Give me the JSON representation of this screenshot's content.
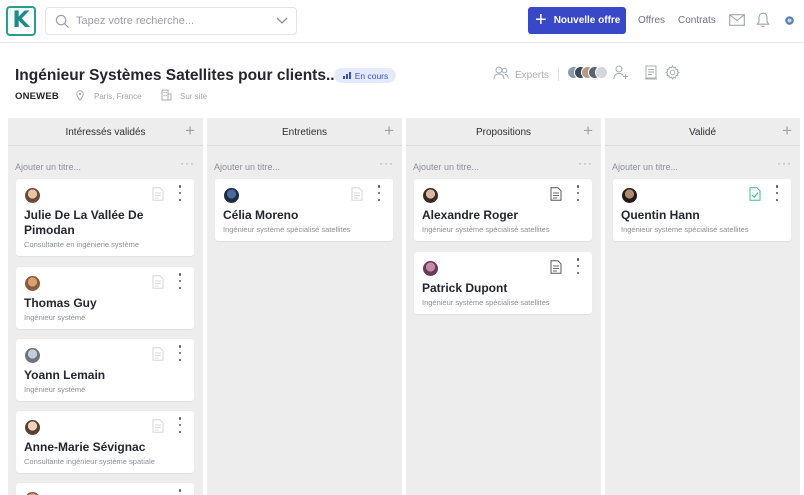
{
  "colors": {
    "accent": "#3848c8",
    "brand": "#2a9d8f",
    "status_bg": "#e4ebff",
    "column_bg": "#ededed"
  },
  "topbar": {
    "logo_letter": "K",
    "search_placeholder": "Tapez votre recherche...",
    "new_offer_label": "Nouvelle offre",
    "nav": [
      "Offres",
      "Contrats"
    ],
    "icons": [
      "mail-icon",
      "bell-icon",
      "user-avatar-icon"
    ]
  },
  "header": {
    "job_title": "Ingénieur Systèmes Satellites pour clients...",
    "status": "En cours",
    "company": "ONEWEB",
    "location": "Paris, France",
    "workplace": "Sur site",
    "experts_label": "Experts"
  },
  "columns": [
    {
      "title": "Intéressés validés",
      "add_title": "Ajouter un titre...",
      "cards": [
        {
          "name": "Julie De La Vallée De Pimodan",
          "role": "Consultante en ingénierie système",
          "doc_status": "empty"
        },
        {
          "name": "Thomas Guy",
          "role": "Ingénieur système",
          "doc_status": "empty"
        },
        {
          "name": "Yoann Lemain",
          "role": "Ingénieur système",
          "doc_status": "empty"
        },
        {
          "name": "Anne-Marie Sévignac",
          "role": "Consultante ingénieur système spatiale",
          "doc_status": "empty"
        }
      ]
    },
    {
      "title": "Entretiens",
      "add_title": "Ajouter un titre...",
      "cards": [
        {
          "name": "Célia Moreno",
          "role": "Ingénieur système spécialisé satellites",
          "doc_status": "empty"
        }
      ]
    },
    {
      "title": "Propositions",
      "add_title": "Ajouter un titre...",
      "cards": [
        {
          "name": "Alexandre Roger",
          "role": "Ingénieur système spécialisé satellites",
          "doc_status": "filled"
        },
        {
          "name": "Patrick Dupont",
          "role": "Ingénieur système spécialisé satellites",
          "doc_status": "filled"
        }
      ]
    },
    {
      "title": "Validé",
      "add_title": "Ajouter un titre...",
      "cards": [
        {
          "name": "Quentin Hann",
          "role": "Ingénieur système spécialisé satellites",
          "doc_status": "validated"
        }
      ]
    }
  ]
}
